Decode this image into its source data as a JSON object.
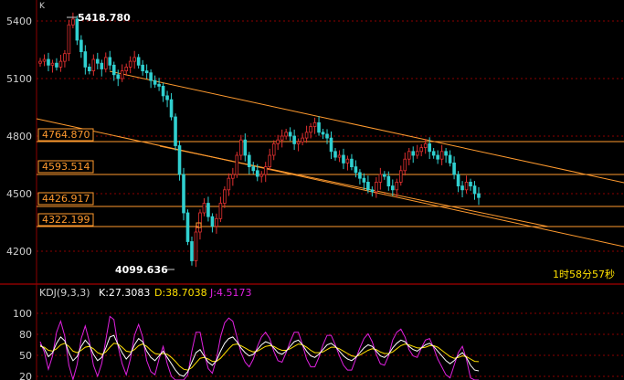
{
  "header": {
    "corner_label": "K"
  },
  "colors": {
    "background": "#000000",
    "axis_text": "#cfcfcf",
    "grid": "#8b0000",
    "up_candle": "#e03030",
    "down_candle": "#30d0d0",
    "trendline": "#ff9a2e",
    "price_line": "#ff9a2e",
    "price_label_border": "#ff9a2e",
    "price_label_text": "#ff9a2e",
    "kdj_k": "#ffffff",
    "kdj_d": "#ffe000",
    "kdj_j": "#e020e0",
    "countdown": "#ffe000"
  },
  "main_chart": {
    "y_axis_ticks": [
      "5400",
      "5100",
      "4800",
      "4500",
      "4200"
    ],
    "high_marker": "5418.780",
    "low_marker": "4099.636",
    "price_levels": [
      {
        "label": "4764.870",
        "value": 4764.87
      },
      {
        "label": "4593.514",
        "value": 4593.514
      },
      {
        "label": "4426.917",
        "value": 4426.917
      },
      {
        "label": "4322.199",
        "value": 4322.199
      }
    ],
    "countdown_text": "1时58分57秒"
  },
  "indicator": {
    "title": "KDJ(9,3,3)",
    "k_label": "K:27.3083",
    "d_label": "D:38.7038",
    "j_label": "J:4.5173",
    "y_axis_ticks": [
      "100",
      "80",
      "50",
      "20"
    ]
  },
  "chart_data": [
    {
      "type": "candlestick",
      "title": "",
      "y_ticks": [
        5400,
        5100,
        4800,
        4500,
        4200
      ],
      "ylim": [
        4050,
        5470
      ],
      "grid": true,
      "annotations": [
        {
          "text": "5418.780",
          "kind": "high",
          "value": 5418.78
        },
        {
          "text": "4099.636",
          "kind": "low",
          "value": 4099.636
        }
      ],
      "horizontal_levels": [
        4764.87,
        4593.514,
        4426.917,
        4322.199
      ],
      "candles_close_approx": [
        5190,
        5200,
        5170,
        5180,
        5160,
        5190,
        5230,
        5380,
        5410,
        5300,
        5240,
        5160,
        5140,
        5200,
        5180,
        5150,
        5210,
        5170,
        5120,
        5100,
        5140,
        5160,
        5190,
        5210,
        5170,
        5140,
        5130,
        5090,
        5070,
        5060,
        5010,
        4990,
        4900,
        4750,
        4600,
        4400,
        4250,
        4150,
        4300,
        4400,
        4450,
        4380,
        4330,
        4370,
        4450,
        4520,
        4580,
        4600,
        4700,
        4780,
        4700,
        4640,
        4620,
        4590,
        4600,
        4640,
        4700,
        4760,
        4780,
        4800,
        4820,
        4800,
        4760,
        4770,
        4790,
        4820,
        4850,
        4870,
        4820,
        4810,
        4790,
        4720,
        4690,
        4700,
        4660,
        4680,
        4640,
        4610,
        4580,
        4560,
        4520,
        4510,
        4560,
        4600,
        4590,
        4540,
        4520,
        4560,
        4620,
        4680,
        4720,
        4700,
        4720,
        4740,
        4760,
        4720,
        4700,
        4680,
        4720,
        4700,
        4660,
        4600,
        4540,
        4520,
        4560,
        4540,
        4500,
        4480
      ]
    },
    {
      "type": "line",
      "title": "",
      "y_ticks": [
        100,
        80,
        50,
        20
      ],
      "series": [
        {
          "name": "K",
          "value_label": "27.3083",
          "values": [
            60,
            55,
            45,
            50,
            62,
            70,
            65,
            50,
            40,
            45,
            58,
            66,
            60,
            48,
            40,
            44,
            56,
            70,
            72,
            60,
            50,
            42,
            48,
            60,
            68,
            64,
            52,
            44,
            40,
            46,
            52,
            44,
            36,
            28,
            22,
            20,
            26,
            38,
            50,
            54,
            46,
            38,
            34,
            40,
            52,
            62,
            68,
            70,
            64,
            56,
            50,
            46,
            48,
            54,
            60,
            64,
            62,
            56,
            50,
            48,
            52,
            58,
            64,
            66,
            60,
            52,
            46,
            44,
            48,
            54,
            60,
            62,
            58,
            52,
            46,
            42,
            40,
            44,
            50,
            56,
            60,
            58,
            52,
            46,
            44,
            48,
            56,
            62,
            66,
            64,
            58,
            54,
            52,
            56,
            60,
            62,
            58,
            52,
            46,
            40,
            36,
            40,
            46,
            50,
            44,
            34,
            28,
            27
          ]
        },
        {
          "name": "D",
          "value_label": "38.7038",
          "values": [
            58,
            57,
            53,
            52,
            55,
            60,
            62,
            58,
            52,
            50,
            53,
            57,
            58,
            55,
            50,
            48,
            51,
            57,
            62,
            61,
            57,
            52,
            51,
            54,
            59,
            61,
            58,
            53,
            49,
            48,
            49,
            48,
            44,
            39,
            33,
            29,
            28,
            31,
            37,
            43,
            44,
            42,
            39,
            39,
            43,
            49,
            55,
            60,
            61,
            59,
            56,
            53,
            51,
            52,
            55,
            58,
            59,
            58,
            55,
            53,
            53,
            55,
            58,
            61,
            60,
            57,
            53,
            50,
            50,
            51,
            54,
            57,
            57,
            55,
            52,
            49,
            46,
            45,
            47,
            50,
            53,
            55,
            54,
            51,
            49,
            49,
            51,
            55,
            59,
            61,
            60,
            58,
            56,
            56,
            57,
            59,
            59,
            57,
            53,
            49,
            45,
            43,
            44,
            46,
            45,
            42,
            39,
            38.7
          ]
        },
        {
          "name": "J",
          "value_label": "4.5173",
          "values": [
            64,
            51,
            29,
            46,
            76,
            90,
            71,
            34,
            16,
            35,
            68,
            84,
            64,
            34,
            20,
            36,
            66,
            96,
            92,
            58,
            36,
            22,
            42,
            72,
            86,
            70,
            40,
            26,
            22,
            42,
            58,
            36,
            20,
            6,
            0,
            2,
            22,
            52,
            76,
            76,
            50,
            30,
            24,
            42,
            70,
            88,
            94,
            90,
            70,
            50,
            38,
            32,
            42,
            58,
            70,
            76,
            68,
            52,
            40,
            38,
            50,
            64,
            76,
            76,
            60,
            42,
            32,
            32,
            44,
            60,
            72,
            72,
            60,
            46,
            34,
            28,
            28,
            42,
            56,
            68,
            74,
            64,
            48,
            36,
            34,
            46,
            66,
            76,
            80,
            70,
            54,
            46,
            44,
            56,
            66,
            68,
            56,
            42,
            32,
            22,
            18,
            34,
            50,
            58,
            42,
            18,
            6,
            4.5
          ]
        }
      ]
    }
  ]
}
